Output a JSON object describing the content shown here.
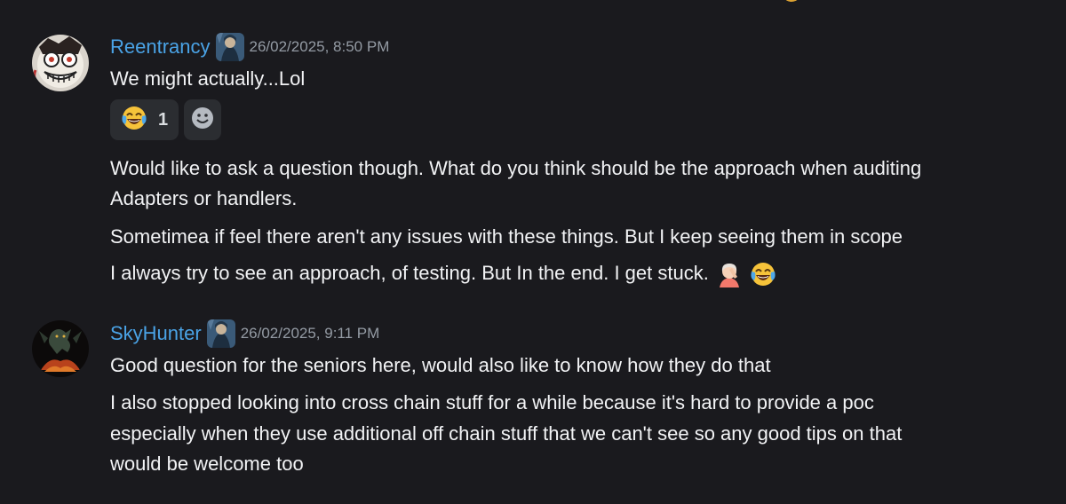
{
  "messages": [
    {
      "author": "Reentrancy",
      "timestamp": "26/02/2025, 8:50 PM",
      "name_color": "#4aa3e6",
      "lines": [
        "We might actually...Lol"
      ],
      "reactions": [
        {
          "emoji": "face-with-tears-of-joy",
          "count": "1"
        }
      ],
      "followups": [
        "Would like to ask a question though. What do you think should be the approach when auditing",
        "Adapters or handlers.",
        "Sometimea if feel there aren't any issues with these things. But I keep seeing them in scope",
        "I always try to see an approach, of testing. But In the end. I get stuck."
      ],
      "followup_emojis": [
        "woman-facepalming",
        "face-with-tears-of-joy"
      ]
    },
    {
      "author": "SkyHunter",
      "timestamp": "26/02/2025, 9:11 PM",
      "name_color": "#4aa3e6",
      "lines": [
        "Good question for the seniors here, would also like to know how they do that",
        "I also stopped looking into cross chain stuff for a while because it's hard to provide a poc",
        "especially when they use additional off chain stuff that we can't see so any good tips on that",
        "would be welcome too"
      ]
    }
  ],
  "colors": {
    "background": "#1a1a1e",
    "text": "#f2f3f5",
    "timestamp": "#949ba4",
    "reaction_bg": "#2b2d31",
    "username": "#4aa3e6"
  },
  "icons": {
    "add_reaction": "add-reaction-smiley-icon",
    "role": "role-badge-icon"
  }
}
